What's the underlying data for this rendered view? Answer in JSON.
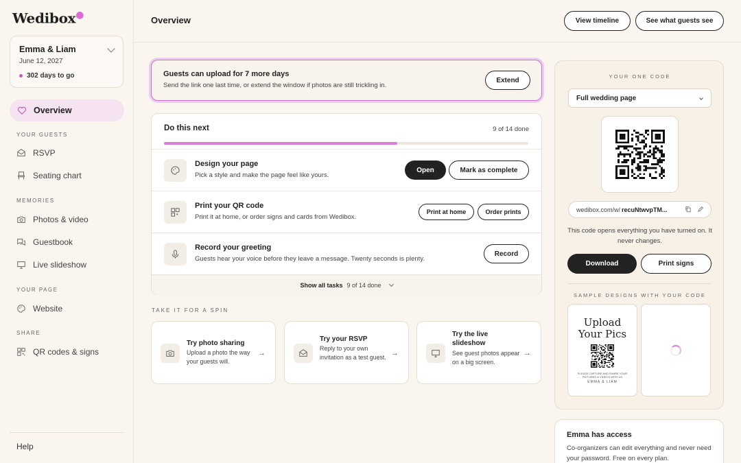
{
  "brand": {
    "name": "Wedibox",
    "accent": "#d77fd7"
  },
  "event": {
    "couple": "Emma & Liam",
    "date": "June 12, 2027",
    "countdown": "302 days to go"
  },
  "nav": {
    "overview": "Overview",
    "sections": {
      "guests": "Your guests",
      "memories": "Memories",
      "page": "Your page",
      "share": "Share"
    },
    "items": {
      "rsvp": "RSVP",
      "seating": "Seating chart",
      "photos": "Photos & video",
      "guestbook": "Guestbook",
      "slideshow": "Live slideshow",
      "website": "Website",
      "qr": "QR codes & signs"
    },
    "help": "Help"
  },
  "header": {
    "title": "Overview",
    "view_timeline": "View timeline",
    "guest_view": "See what guests see"
  },
  "banner": {
    "title": "Guests can upload for 7 more days",
    "subtitle": "Send the link one last time, or extend the window if photos are still trickling in.",
    "action": "Extend"
  },
  "todo": {
    "title": "Do this next",
    "count": "9 of 14 done",
    "progress": 0.64,
    "tasks": [
      {
        "title": "Design your page",
        "subtitle": "Pick a style and make the page feel like yours.",
        "primary": "Open",
        "secondary": "Mark as complete"
      },
      {
        "title": "Print your QR code",
        "subtitle": "Print it at home, or order signs and cards from Wedibox.",
        "primary": "Print at home",
        "secondary": "Order prints"
      },
      {
        "title": "Record your greeting",
        "subtitle": "Guests hear your voice before they leave a message. Twenty seconds is plenty.",
        "primary": "Record"
      }
    ],
    "show_all": "Show all tasks",
    "show_all_count": "9 of 14 done"
  },
  "spin": {
    "label": "Take it for a spin",
    "cards": [
      {
        "title": "Try photo sharing",
        "subtitle": "Upload a photo the way your guests will."
      },
      {
        "title": "Try your RSVP",
        "subtitle": "Reply to your own invitation as a test guest."
      },
      {
        "title": "Try the live slideshow",
        "subtitle": "See guest photos appear on a big screen."
      }
    ]
  },
  "qr": {
    "label": "Your one code",
    "select_value": "Full wedding page",
    "url_prefix": "wedibox.com/w/",
    "url_code": "recuNtwvpTM...",
    "description": "This code opens everything you have turned on. It never changes.",
    "download": "Download",
    "print_signs": "Print signs",
    "samples_label": "Sample designs with your code",
    "sample": {
      "line1": "Upload",
      "line2": "Your Pics",
      "caption": "PLEASE CAPTURE AND SHARE YOUR PICTURES & VIDEOS WITH US",
      "names": "EMMA & LIAM"
    }
  },
  "access": {
    "title": "Emma has access",
    "subtitle": "Co-organizers can edit everything and never need your password. Free on every plan."
  }
}
